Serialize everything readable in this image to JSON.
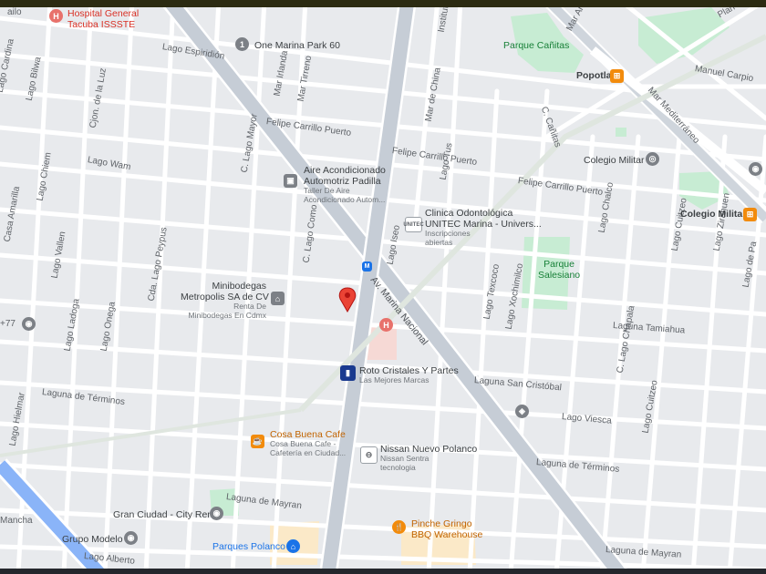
{
  "hospital_top": {
    "line1": "Hospital General",
    "line2": "Tacuba ISSSTE"
  },
  "one_marina": "One Marina Park 60",
  "parque_canitas": "Parque Cañitas",
  "popotla": "Popotla",
  "manuel_carpio": "Manuel Carpio",
  "plan_de": "Plan de",
  "aire": {
    "line1": "Aire Acondicionado",
    "line2": "Automotriz Padilla",
    "sub1": "Taller De Aire",
    "sub2": "Acondicionado Autom..."
  },
  "clinica": {
    "line1": "Clinica Odontológica",
    "line2": "UNITEC Marina - Univers...",
    "sub1": "Inscripciones",
    "sub2": "abiertas",
    "badge": "UNITEC"
  },
  "colegio_militar_poi": "Colegio Militar",
  "colegio_militar_station": "Colegio Militar",
  "parque_salesiano": {
    "line1": "Parque",
    "line2": "Salesiano"
  },
  "minibodegas": {
    "line1": "Minibodegas",
    "line2": "Metropolis SA de CV",
    "sub1": "Renta De",
    "sub2": "Minibodegas En Cdmx"
  },
  "roto": {
    "line1": "Roto Cristales Y Partes",
    "sub1": "Las Mejores Marcas"
  },
  "cosa_buena": {
    "line1": "Cosa Buena Cafe",
    "sub1": "Cosa Buena Cafe -",
    "sub2": "Cafetería en Ciudad..."
  },
  "nissan": {
    "line1": "Nissan Nuevo Polanco",
    "sub1": "Nissan Sentra",
    "sub2": "tecnologia"
  },
  "gran_ciudad": "Gran Ciudad - City Rent",
  "grupo_modelo": "Grupo Modelo",
  "parques_polanco": "Parques Polanco",
  "pinche_gringo": {
    "line1": "Pinche Gringo",
    "line2": "BBQ Warehouse"
  },
  "edge_77": "+77",
  "pin_letters": {
    "hospital": "H",
    "one": "1",
    "aire": "▣",
    "colegio": "◎",
    "mini": "⌂",
    "roto": "▮",
    "cosa": "☕",
    "nissan": "⊖",
    "gran": "◉",
    "grupo": "◉",
    "parques": "⌂",
    "pinche": "🍴",
    "station": "⊞",
    "popotla": "⊞",
    "hosp2": "H",
    "green": "◈",
    "metro": "M"
  },
  "streets": {
    "lago_espiridion": "Lago Espiridión",
    "lago_cardina": "Lago Cardina",
    "lago_bilwa": "Lago Bilwa",
    "cjon_luz": "Cjon. de la Luz",
    "lago_mayor": "C. Lago Mayor",
    "mar_irlanda": "Mar Irlanda",
    "mar_tirreno": "Mar Tirreno",
    "mar_china": "Mar de China",
    "institutos": "Institutos",
    "felipe1": "Felipe Carrillo Puerto",
    "felipe2": "Felipe Carrillo Puerto",
    "felipe3": "Felipe Carrillo Puerto",
    "lago_wam": "Lago Wam",
    "lago_chiem": "Lago Chiem",
    "lago_tus": "Lago Tus",
    "casa_amarilla": "Casa Amarilla",
    "lago_como": "C. Lago Como",
    "lago_iseo": "Lago Iseo",
    "av_marina": "Av. Marina Nacional",
    "lago_chalco": "Lago Chalco",
    "lago_cuitzeo1": "Lago Cuitzeo",
    "lago_zirahuen": "Lago Zirahuen",
    "lago_pa": "Lago de Pa",
    "lago_vallen": "Lago Vallen",
    "lago_peypus": "Cda. Lago Peypus",
    "lago_texcoco": "Lago Texcoco",
    "lago_xochimilco": "Lago Xochimilco",
    "laguna_tamiahua": "Laguna Tamiahua",
    "lago_chapala": "C. Lago Chapala",
    "lago_ladoga": "Lago Ladoga",
    "lago_onega": "Lago Onega",
    "laguna_terminos1": "Laguna de Términos",
    "laguna_sancristobal": "Laguna San Cristóbal",
    "lago_viesca": "Lago Viesca",
    "lago_cuitzeo2": "Lago Cuitzeo",
    "lago_hielmar": "Lago Hielmar",
    "laguna_terminos2": "Laguna de Términos",
    "laguna_mayran1": "Laguna de Mayran",
    "laguna_mayran2": "Laguna de Mayran",
    "mancha": "Mancha",
    "lago_alberto": "Lago Alberto",
    "mar_mediterraneo": "Mar Mediterráneo",
    "c_canitas": "C. Cañitas",
    "mar_an": "Mar An"
  }
}
